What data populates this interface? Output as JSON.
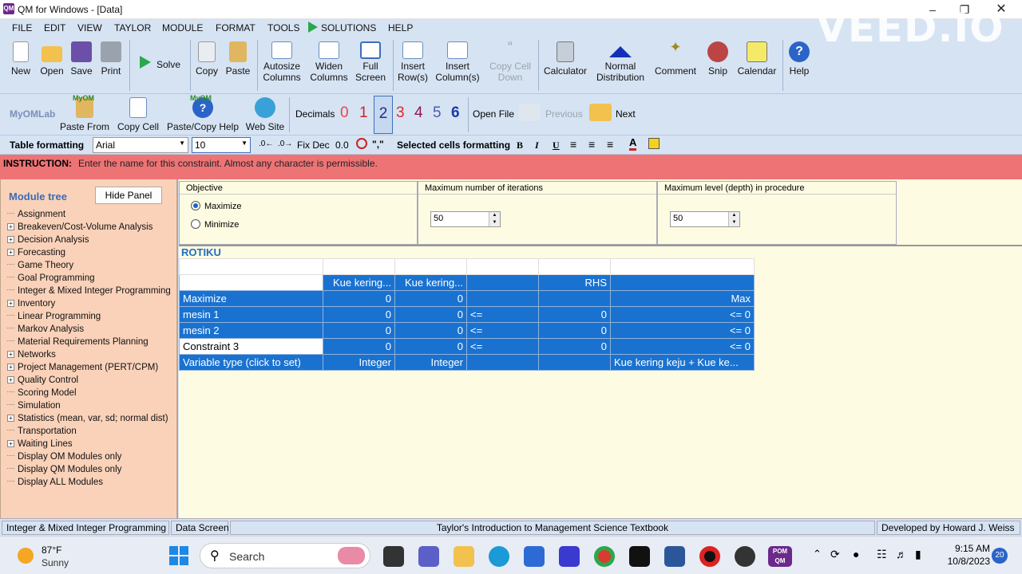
{
  "window": {
    "title": "QM for Windows - [Data]",
    "app_icon_text": "QM"
  },
  "watermark": "VEED.IO",
  "menu": [
    "FILE",
    "EDIT",
    "VIEW",
    "TAYLOR",
    "MODULE",
    "FORMAT",
    "TOOLS",
    "SOLUTIONS",
    "HELP"
  ],
  "toolbar": {
    "new": "New",
    "open": "Open",
    "save": "Save",
    "print": "Print",
    "solve": "Solve",
    "copy": "Copy",
    "paste": "Paste",
    "autosize_1": "Autosize",
    "autosize_2": "Columns",
    "widen_1": "Widen",
    "widen_2": "Columns",
    "full_1": "Full",
    "full_2": "Screen",
    "insert_row_1": "Insert",
    "insert_row_2": "Row(s)",
    "insert_col_1": "Insert",
    "insert_col_2": "Column(s)",
    "copy_cell_1": "Copy Cell",
    "copy_cell_2": "Down",
    "calculator": "Calculator",
    "normal_1": "Normal",
    "normal_2": "Distribution",
    "comment": "Comment",
    "snip": "Snip",
    "calendar": "Calendar",
    "help": "Help"
  },
  "toolbar2": {
    "myomlab": "MyOMLab",
    "myom_badge": "MyOM",
    "paste_from": "Paste From",
    "copy_cell": "Copy Cell",
    "paste_copy_help": "Paste/Copy Help",
    "web_site": "Web Site",
    "decimals_label": "Decimals",
    "decimals": [
      "0",
      "1",
      "2",
      "3",
      "4",
      "5",
      "6"
    ],
    "open_file": "Open File",
    "previous": "Previous",
    "next": "Next"
  },
  "formatbar": {
    "table_formatting": "Table formatting",
    "font": "Arial",
    "size": "10",
    "fix_dec": "Fix Dec",
    "zero": "0.0",
    "selected_cells": "Selected cells formatting",
    "comma": "\",\"",
    "bold": "B",
    "italic": "I",
    "underline": "U"
  },
  "instruction": {
    "label": "INSTRUCTION:",
    "text": "Enter the name for this constraint. Almost any character is permissible."
  },
  "sidebar": {
    "heading": "Module tree",
    "hide_panel": "Hide Panel",
    "items": [
      {
        "label": "Assignment",
        "expand": false
      },
      {
        "label": "Breakeven/Cost-Volume Analysis",
        "expand": true
      },
      {
        "label": "Decision Analysis",
        "expand": true
      },
      {
        "label": "Forecasting",
        "expand": true
      },
      {
        "label": "Game Theory",
        "expand": false
      },
      {
        "label": "Goal Programming",
        "expand": false
      },
      {
        "label": "Integer & Mixed Integer Programming",
        "expand": false
      },
      {
        "label": "Inventory",
        "expand": true
      },
      {
        "label": "Linear Programming",
        "expand": false
      },
      {
        "label": "Markov Analysis",
        "expand": false
      },
      {
        "label": "Material Requirements Planning",
        "expand": false
      },
      {
        "label": "Networks",
        "expand": true
      },
      {
        "label": "Project Management (PERT/CPM)",
        "expand": true
      },
      {
        "label": "Quality Control",
        "expand": true
      },
      {
        "label": "Scoring Model",
        "expand": false
      },
      {
        "label": "Simulation",
        "expand": false
      },
      {
        "label": "Statistics (mean, var, sd; normal dist)",
        "expand": true
      },
      {
        "label": "Transportation",
        "expand": false
      },
      {
        "label": "Waiting Lines",
        "expand": true
      },
      {
        "label": "Display OM Modules only",
        "expand": false
      },
      {
        "label": "Display QM Modules only",
        "expand": false
      },
      {
        "label": "Display ALL Modules",
        "expand": false
      }
    ]
  },
  "options": {
    "objective_title": "Objective",
    "maximize": "Maximize",
    "minimize": "Minimize",
    "selected": "Maximize",
    "iterations_title": "Maximum number of iterations",
    "iterations_value": "50",
    "depth_title": "Maximum level (depth) in procedure",
    "depth_value": "50"
  },
  "data_title": "ROTIKU",
  "table": {
    "header": [
      "",
      "Kue kering...",
      "Kue kering...",
      "",
      "RHS",
      ""
    ],
    "rows": [
      [
        "Maximize",
        "0",
        "0",
        "",
        "",
        "Max"
      ],
      [
        "mesin 1",
        "0",
        "0",
        "<=",
        "0",
        "<= 0"
      ],
      [
        "mesin 2",
        "0",
        "0",
        "<=",
        "0",
        "<= 0"
      ],
      [
        "Constraint 3",
        "0",
        "0",
        "<=",
        "0",
        "<= 0"
      ],
      [
        "Variable type (click to set)",
        "Integer",
        "Integer",
        "",
        "",
        "Kue kering keju + Kue ke..."
      ]
    ]
  },
  "status": {
    "module": "Integer & Mixed Integer Programming",
    "screen": "Data Screen",
    "textbook": "Taylor's Introduction to Management Science Textbook",
    "developer": "Developed by Howard J. Weiss"
  },
  "taskbar": {
    "temp": "87°F",
    "weather": "Sunny",
    "search": "Search",
    "time": "9:15 AM",
    "date": "10/8/2023",
    "badge": "20",
    "pom_qm": "POM QM"
  }
}
